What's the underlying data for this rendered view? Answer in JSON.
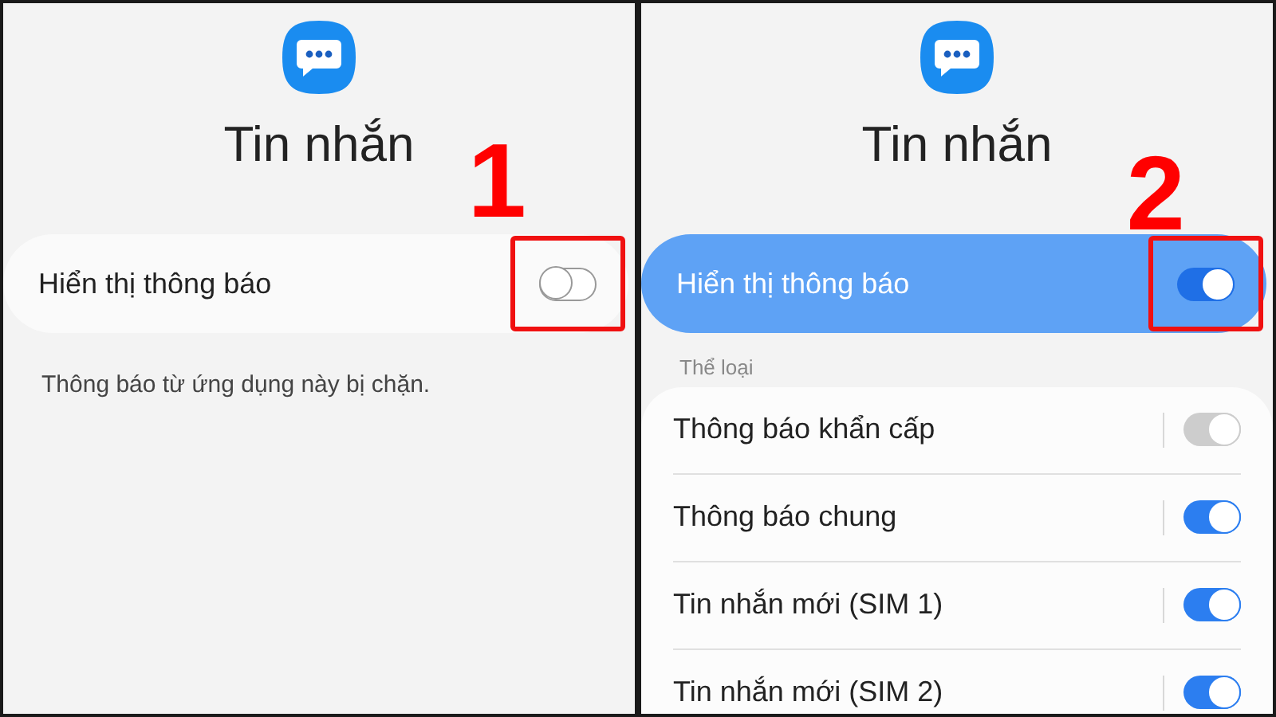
{
  "panels": [
    {
      "title": "Tin nhắn",
      "step": "1",
      "master": {
        "label": "Hiển thị thông báo",
        "on": false,
        "highlighted": true
      },
      "note": "Thông báo từ ứng dụng này bị chặn."
    },
    {
      "title": "Tin nhắn",
      "step": "2",
      "master": {
        "label": "Hiển thị thông báo",
        "on": true,
        "highlighted": true
      },
      "category_heading": "Thể loại",
      "categories": [
        {
          "label": "Thông báo khẩn cấp",
          "on": true,
          "disabled": true
        },
        {
          "label": "Thông báo chung",
          "on": true,
          "disabled": false
        },
        {
          "label": "Tin nhắn mới (SIM 1)",
          "on": true,
          "disabled": false
        },
        {
          "label": "Tin nhắn mới (SIM 2)",
          "on": true,
          "disabled": false
        }
      ]
    }
  ]
}
